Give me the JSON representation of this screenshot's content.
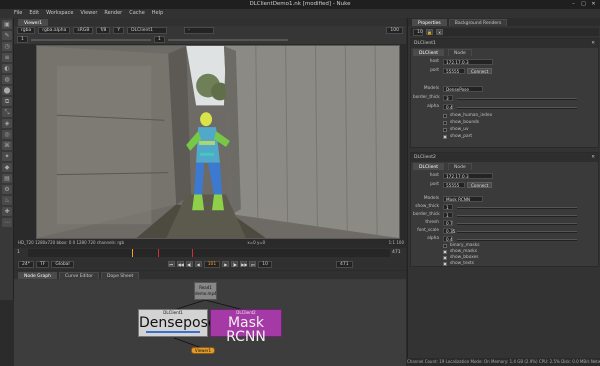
{
  "window": {
    "title": "DLClientDemo1.nk [modified] - Nuke"
  },
  "menu": [
    "File",
    "Edit",
    "Workspace",
    "Viewer",
    "Render",
    "Cache",
    "Help"
  ],
  "viewer": {
    "tab": "Viewer1",
    "channels": "rgba",
    "channel_alpha": "rgba.alpha",
    "colorspace": "sRGB",
    "zoom": "100",
    "gain_label": "f/8",
    "gamma_label": "Y",
    "ab_input": "DLClient1",
    "proxy": "1",
    "frame_label": "1",
    "status_left": "HD_720 1280x720  bbox: 0 0 1280 720 channels: rgb",
    "status_mid": "x=0 y=0",
    "status_right": "1:1 100"
  },
  "timeline": {
    "start_frame": "1",
    "end_frame": "471",
    "current_frame": "101",
    "fps": "24*",
    "playback": "TF",
    "mode": "Global",
    "step": "10",
    "range_end": "471"
  },
  "nodegraph": {
    "tabs": [
      "Node Graph",
      "Curve Editor",
      "Dope Sheet"
    ],
    "read_node": {
      "label": "Read1",
      "sub": "demo.mp4"
    },
    "dense_node": {
      "title": "DLClient1",
      "label": "Densepose"
    },
    "mask_node": {
      "title": "DLClient2",
      "label": "Mask RCNN"
    },
    "viewer_node": "Viewer1"
  },
  "properties": {
    "tabs": [
      "Properties",
      "Background Renders"
    ],
    "panel1": {
      "name": "DLClient1",
      "tabs": [
        "DLClient",
        "Node"
      ],
      "host_label": "host",
      "host": "172.17.0.3",
      "port_label": "port",
      "port": "55555",
      "connect": "Connect",
      "models_label": "Models",
      "model": "DensePose",
      "border_label": "border_thick",
      "border": "3",
      "alpha_label": "alpha",
      "alpha": "0.4",
      "checks": [
        "show_human_index",
        "show_bounds",
        "show_uv",
        "show_part"
      ],
      "check_states": [
        false,
        false,
        false,
        true
      ]
    },
    "panel2": {
      "name": "DLClient2",
      "tabs": [
        "DLClient",
        "Node"
      ],
      "host_label": "host",
      "host": "172.17.0.3",
      "port_label": "port",
      "port": "55555",
      "connect": "Connect",
      "models_label": "Models",
      "model": "Mask RCNN",
      "rows": [
        {
          "label": "show_thick",
          "value": "1"
        },
        {
          "label": "border_thick",
          "value": "1"
        },
        {
          "label": "thresh",
          "value": "0.7"
        },
        {
          "label": "font_scale",
          "value": "0.35"
        },
        {
          "label": "alpha",
          "value": "0.4"
        }
      ],
      "checks": [
        "show_bboxes",
        "show_masks",
        "show_bboxes",
        "show_texts"
      ],
      "check_states": [
        false,
        true,
        true,
        true
      ],
      "binary_label": "binary_masks"
    }
  },
  "status": "Channel Count: 19  Localization Mode: On  Memory: 1.4 GB (2.9%)  CPU: 2.5%  Disk: 0.0 MB/s  Network: 0.1 MB/s",
  "colors": {
    "accent": "#ff9a1f",
    "dense_node": "#d3d3d3",
    "mask_node": "#a53aa6",
    "viewer_node": "#e39b2a"
  }
}
